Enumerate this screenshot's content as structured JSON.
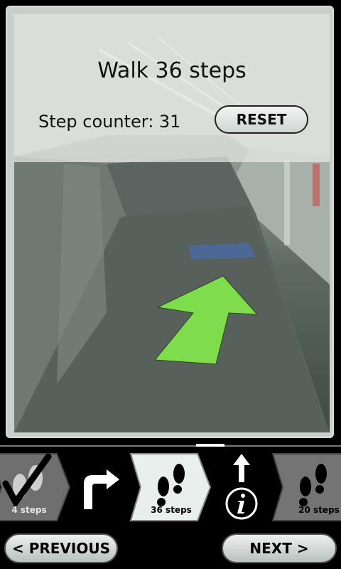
{
  "instruction": {
    "title": "Walk 36 steps",
    "counter_text": "Step counter: 31"
  },
  "controls": {
    "reset_label": "RESET"
  },
  "steps": [
    {
      "label": "4 steps",
      "state": "completed"
    },
    {
      "label": "36 steps",
      "state": "current"
    },
    {
      "label": "20 steps",
      "state": "upcoming"
    }
  ],
  "turns": [
    {
      "icon": "turn-right-icon"
    },
    {
      "icon": "straight-arrow-icon"
    }
  ],
  "navigation": {
    "previous_label": "< PREVIOUS",
    "next_label": "NEXT >"
  },
  "colors": {
    "arrow": "#7fdc4c",
    "button": "#d6dcd9",
    "background": "#000000"
  }
}
